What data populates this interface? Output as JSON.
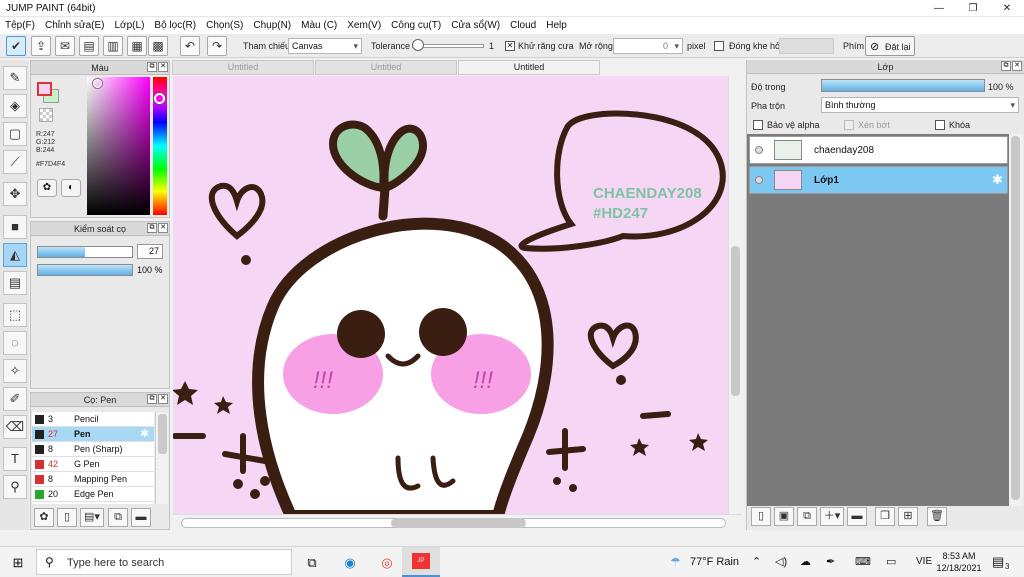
{
  "window": {
    "title": "JUMP PAINT (64bit)"
  },
  "menu": [
    "Tệp(F)",
    "Chỉnh sửa(E)",
    "Lớp(L)",
    "Bộ lọc(R)",
    "Chọn(S)",
    "Chụp(N)",
    "Màu (C)",
    "Xem(V)",
    "Công cụ(T)",
    "Cửa sổ(W)",
    "Cloud",
    "Help"
  ],
  "toolbar": {
    "reference_label": "Tham chiếu",
    "reference_value": "Canvas",
    "tolerance_label": "Tolerance",
    "tolerance_value": "1",
    "antialias_label": "Khử răng cưa",
    "expand_label": "Mở rộng",
    "expand_value": "0",
    "pixel_label": "pixel",
    "closegap_label": "Đóng khe hở",
    "key_label": "Phím",
    "reset_label": "Đặt lại",
    "tolerance_level": 0
  },
  "color_panel": {
    "title": "Màu",
    "r": "R:247",
    "g": "G:212",
    "b": "B:244",
    "hex": "#F7D4F4",
    "fg_color": "#f7d4f4",
    "bg_color": "#c8f0c8"
  },
  "brush_control": {
    "title": "Kiểm soát cọ",
    "size": "27",
    "opacity": "100 %",
    "size_level": 0.27,
    "opacity_level": 1.0
  },
  "brush_list": {
    "title": "Cọ: Pen",
    "items": [
      {
        "size": "3",
        "name": "Pencil",
        "color": "#222222",
        "red": false
      },
      {
        "size": "27",
        "name": "Pen",
        "color": "#222222",
        "red": true
      },
      {
        "size": "8",
        "name": "Pen (Sharp)",
        "color": "#222222",
        "red": false
      },
      {
        "size": "42",
        "name": "G Pen",
        "color": "#d83030",
        "red": true
      },
      {
        "size": "8",
        "name": "Mapping Pen",
        "color": "#d83030",
        "red": false
      },
      {
        "size": "20",
        "name": "Edge Pen",
        "color": "#28a828",
        "red": false
      }
    ]
  },
  "tabs": [
    "Untitled",
    "Untitled",
    "Untitled"
  ],
  "canvas": {
    "bg_color": "#f5d7f5",
    "bubble_line1": "CHAENDAY208",
    "bubble_line2": "#HD247",
    "cheek_mark": "!!!"
  },
  "layers_panel": {
    "title": "Lớp",
    "opacity_label": "Độ trong",
    "opacity_value": "100 %",
    "opacity_level": 1.0,
    "blend_label": "Pha trộn",
    "blend_value": "Bình thường",
    "protect_alpha": "Bảo vệ alpha",
    "clip": "Xén bớt",
    "lock": "Khóa",
    "layers": [
      {
        "name": "chaenday208",
        "selected": false
      },
      {
        "name": "Lớp1",
        "selected": true
      }
    ]
  },
  "taskbar": {
    "search_placeholder": "Type here to search",
    "weather": "77°F  Rain",
    "lang": "VIE",
    "time": "8:53 AM",
    "date": "12/18/2021",
    "notif": "3"
  }
}
